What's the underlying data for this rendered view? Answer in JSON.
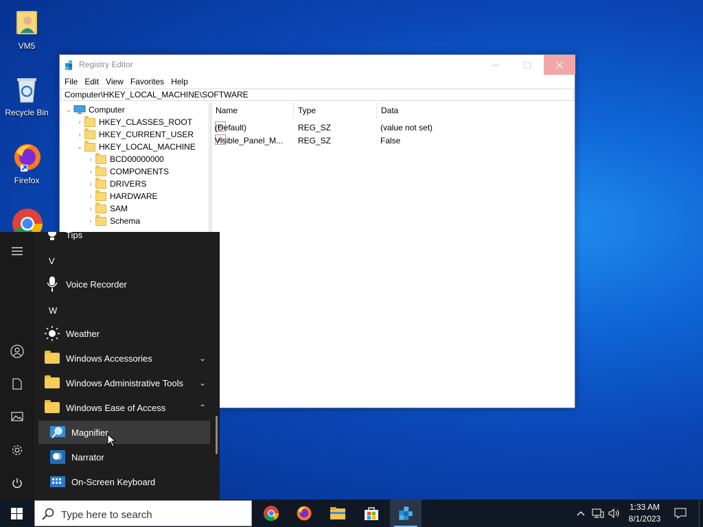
{
  "desktop": {
    "icons": [
      {
        "label": "VM5"
      },
      {
        "label": "Recycle Bin"
      },
      {
        "label": "Firefox"
      },
      {
        "label": ""
      }
    ]
  },
  "regedit": {
    "title": "Registry Editor",
    "menu": [
      "File",
      "Edit",
      "View",
      "Favorites",
      "Help"
    ],
    "address": "Computer\\HKEY_LOCAL_MACHINE\\SOFTWARE",
    "tree": [
      {
        "label": "Computer",
        "level": 0,
        "expanded": true
      },
      {
        "label": "HKEY_CLASSES_ROOT",
        "level": 1,
        "expanded": false
      },
      {
        "label": "HKEY_CURRENT_USER",
        "level": 1,
        "expanded": false
      },
      {
        "label": "HKEY_LOCAL_MACHINE",
        "level": 1,
        "expanded": true
      },
      {
        "label": "BCD00000000",
        "level": 2,
        "expanded": false
      },
      {
        "label": "COMPONENTS",
        "level": 2,
        "expanded": false
      },
      {
        "label": "DRIVERS",
        "level": 2,
        "expanded": false
      },
      {
        "label": "HARDWARE",
        "level": 2,
        "expanded": false
      },
      {
        "label": "SAM",
        "level": 2,
        "expanded": false
      },
      {
        "label": "Schema",
        "level": 2,
        "expanded": false
      }
    ],
    "columns": {
      "name": "Name",
      "type": "Type",
      "data": "Data"
    },
    "values": [
      {
        "name": "(Default)",
        "type": "REG_SZ",
        "data": "(value not set)"
      },
      {
        "name": "Visible_Panel_M...",
        "type": "REG_SZ",
        "data": "False"
      }
    ]
  },
  "startmenu": {
    "items": [
      {
        "kind": "app",
        "label": "Tips",
        "icon": "lightbulb-icon"
      },
      {
        "kind": "letter",
        "label": "V"
      },
      {
        "kind": "app",
        "label": "Voice Recorder",
        "icon": "microphone-icon"
      },
      {
        "kind": "letter",
        "label": "W"
      },
      {
        "kind": "app",
        "label": "Weather",
        "icon": "sun-icon"
      },
      {
        "kind": "folder",
        "label": "Windows Accessories",
        "expanded": false
      },
      {
        "kind": "folder",
        "label": "Windows Administrative Tools",
        "expanded": false
      },
      {
        "kind": "folder",
        "label": "Windows Ease of Access",
        "expanded": true
      },
      {
        "kind": "sub",
        "label": "Magnifier",
        "icon": "magnifier-icon",
        "highlighted": true
      },
      {
        "kind": "sub",
        "label": "Narrator",
        "icon": "narrator-icon"
      },
      {
        "kind": "sub",
        "label": "On-Screen Keyboard",
        "icon": "keyboard-icon"
      }
    ]
  },
  "taskbar": {
    "search_placeholder": "Type here to search",
    "apps": [
      "chrome-icon",
      "firefox-icon",
      "file-explorer-icon",
      "microsoft-store-icon",
      "registry-editor-icon"
    ],
    "clock": {
      "time": "1:33 AM",
      "date": "8/1/2023"
    }
  },
  "colors": {
    "accent": "#0a47b5",
    "taskbar": "#101824",
    "startmenu": "#1e1e1e",
    "close_hover": "#f2a7a7"
  }
}
